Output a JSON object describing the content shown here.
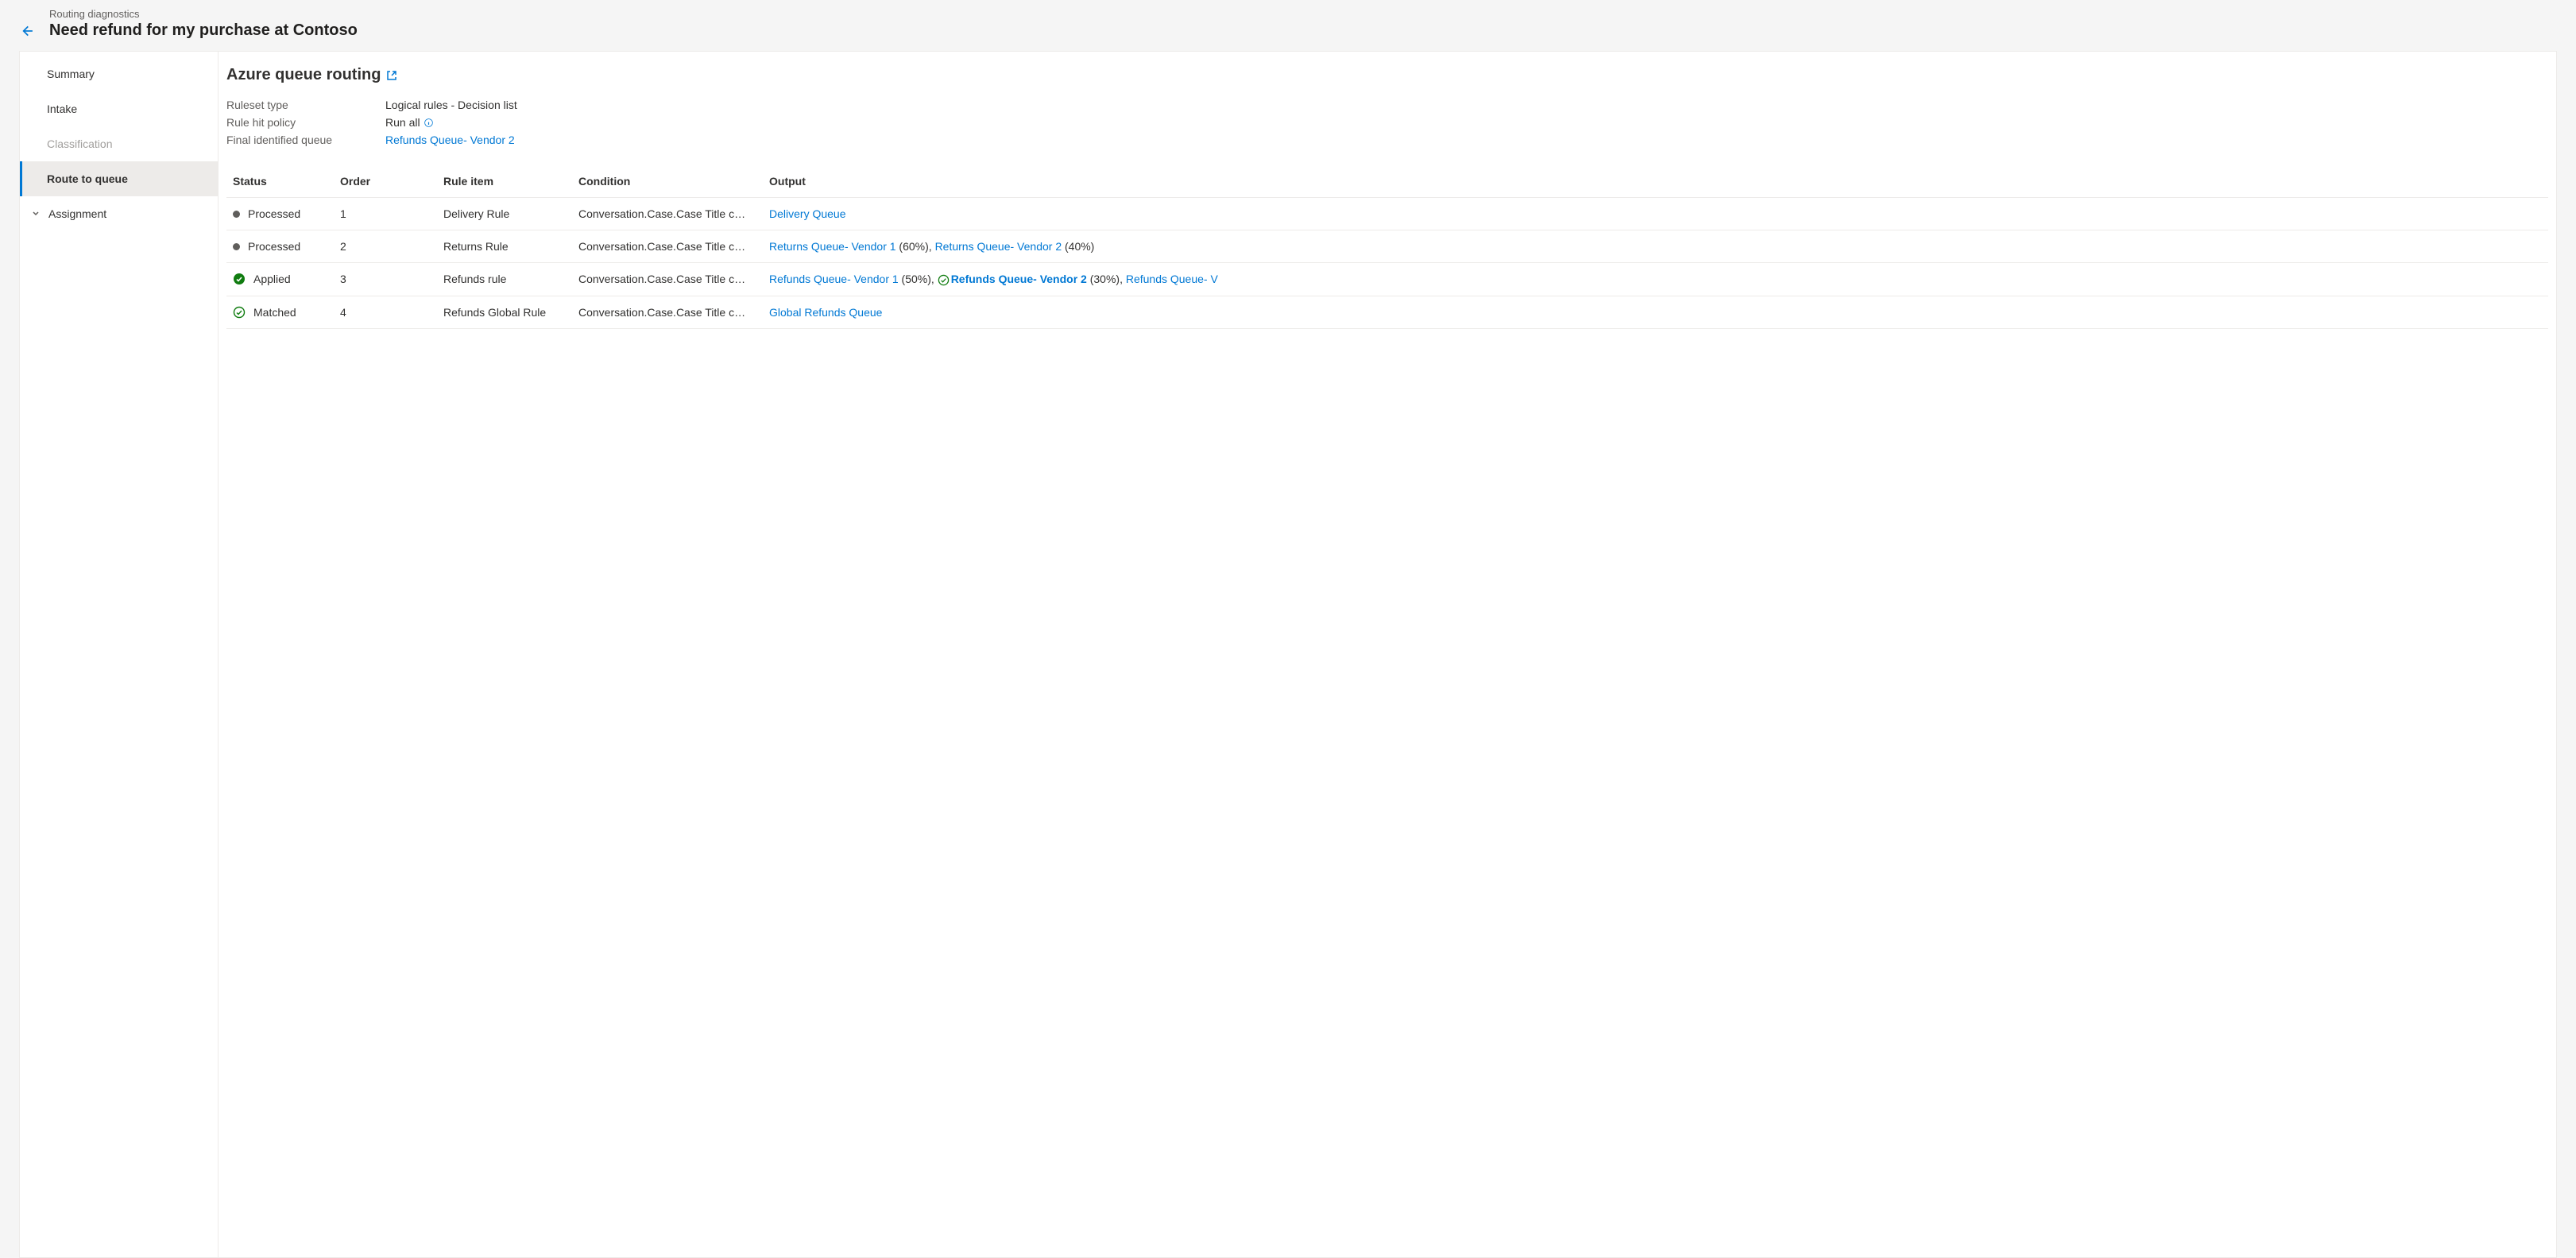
{
  "header": {
    "breadcrumb": "Routing diagnostics",
    "title": "Need refund for my purchase at Contoso"
  },
  "sidebar": {
    "items": [
      {
        "label": "Summary",
        "state": "normal"
      },
      {
        "label": "Intake",
        "state": "normal"
      },
      {
        "label": "Classification",
        "state": "disabled"
      },
      {
        "label": "Route to queue",
        "state": "active"
      },
      {
        "label": "Assignment",
        "state": "chevron"
      }
    ]
  },
  "main": {
    "title": "Azure queue routing",
    "meta": [
      {
        "label": "Ruleset type",
        "value": "Logical rules - Decision list",
        "type": "text"
      },
      {
        "label": "Rule hit policy",
        "value": "Run all",
        "type": "info"
      },
      {
        "label": "Final identified queue",
        "value": "Refunds Queue- Vendor 2",
        "type": "link"
      }
    ],
    "columns": [
      "Status",
      "Order",
      "Rule item",
      "Condition",
      "Output"
    ],
    "rows": [
      {
        "status_icon": "dot",
        "status": "Processed",
        "order": "1",
        "rule": "Delivery Rule",
        "condition": "Conversation.Case.Case Title c…",
        "output": [
          {
            "text": "Delivery Queue",
            "type": "link"
          }
        ]
      },
      {
        "status_icon": "dot",
        "status": "Processed",
        "order": "2",
        "rule": "Returns Rule",
        "condition": "Conversation.Case.Case Title c…",
        "output": [
          {
            "text": "Returns Queue- Vendor 1",
            "type": "link"
          },
          {
            "text": " (60%), ",
            "type": "plain"
          },
          {
            "text": "Returns Queue- Vendor 2",
            "type": "link"
          },
          {
            "text": " (40%)",
            "type": "plain"
          }
        ]
      },
      {
        "status_icon": "check-solid",
        "status": "Applied",
        "order": "3",
        "rule": "Refunds rule",
        "condition": "Conversation.Case.Case Title c…",
        "output": [
          {
            "text": "Refunds Queue- Vendor 1",
            "type": "link"
          },
          {
            "text": " (50%), ",
            "type": "plain"
          },
          {
            "text": "",
            "type": "inline-check"
          },
          {
            "text": "Refunds Queue- Vendor 2",
            "type": "bold-link"
          },
          {
            "text": " (30%), ",
            "type": "plain"
          },
          {
            "text": "Refunds Queue- V",
            "type": "link"
          }
        ]
      },
      {
        "status_icon": "check-outline",
        "status": "Matched",
        "order": "4",
        "rule": "Refunds Global Rule",
        "condition": "Conversation.Case.Case Title c…",
        "output": [
          {
            "text": "Global Refunds Queue",
            "type": "link"
          }
        ]
      }
    ]
  }
}
